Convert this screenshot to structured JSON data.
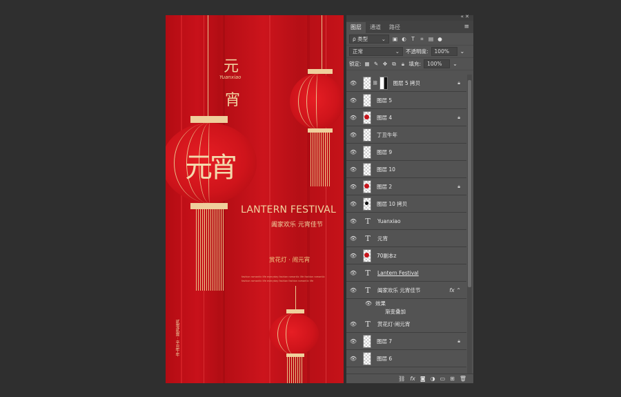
{
  "poster": {
    "title_top": "元",
    "title_bottom": "宵",
    "script_word": "Yuanxiao",
    "lantern_big_text": "元宵",
    "en_title": "LANTERN FESTIVAL",
    "cn_sub": "阖家欢乐  元宵佳节",
    "cn_sub2": "赏花灯 · 闹元宵",
    "small_line1": "fashion romantic life  everyday fashion romantic life  fashion romantic",
    "small_line2": "fashion romantic life  everyday fashion  fashion romantic life",
    "vertical_text": "贰零贰壹 · 辛丑牛年",
    "colors": {
      "bg": "#c8111a",
      "gold": "#efcf9c"
    }
  },
  "panel": {
    "tabs": [
      "图层",
      "通道",
      "路径"
    ],
    "active_tab": "图层",
    "filter_label": "ρ 类型",
    "blend_mode": "正常",
    "opacity_label": "不透明度:",
    "opacity_value": "100%",
    "lock_label": "锁定:",
    "fill_label": "填充:",
    "fill_value": "100%",
    "layers": [
      {
        "name": "图层 5 拷贝",
        "kind": "mask",
        "locked": true
      },
      {
        "name": "图层 5",
        "kind": "pixel",
        "locked": false
      },
      {
        "name": "图层 4",
        "kind": "red",
        "locked": true
      },
      {
        "name": "丁丑牛年",
        "kind": "pixel",
        "locked": false
      },
      {
        "name": "图层 9",
        "kind": "pixel",
        "locked": false
      },
      {
        "name": "图层 10",
        "kind": "pixel",
        "locked": false
      },
      {
        "name": "图层 2",
        "kind": "red",
        "locked": true
      },
      {
        "name": "图层 10 拷贝",
        "kind": "dot",
        "locked": false
      },
      {
        "name": "Yuanxiao",
        "kind": "text",
        "locked": false
      },
      {
        "name": "元宵",
        "kind": "text",
        "locked": false
      },
      {
        "name": "70副本z",
        "kind": "smart",
        "locked": false
      },
      {
        "name": "Lantern Festival",
        "kind": "text",
        "locked": false,
        "underline": true
      },
      {
        "name": "阖家欢乐    元宵佳节",
        "kind": "text",
        "locked": false,
        "fx": true
      },
      {
        "name": "效果",
        "kind": "effect-head"
      },
      {
        "name": "渐变叠加",
        "kind": "effect"
      },
      {
        "name": "赏花灯·闹元宵",
        "kind": "text",
        "locked": false
      },
      {
        "name": "图层 7",
        "kind": "pixel",
        "locked": true
      },
      {
        "name": "图层 6",
        "kind": "pixel",
        "locked": false
      }
    ],
    "bottom_icons": [
      "link-icon",
      "fx-icon",
      "mask-icon",
      "adjustment-icon",
      "folder-icon",
      "new-layer-icon",
      "trash-icon"
    ]
  }
}
